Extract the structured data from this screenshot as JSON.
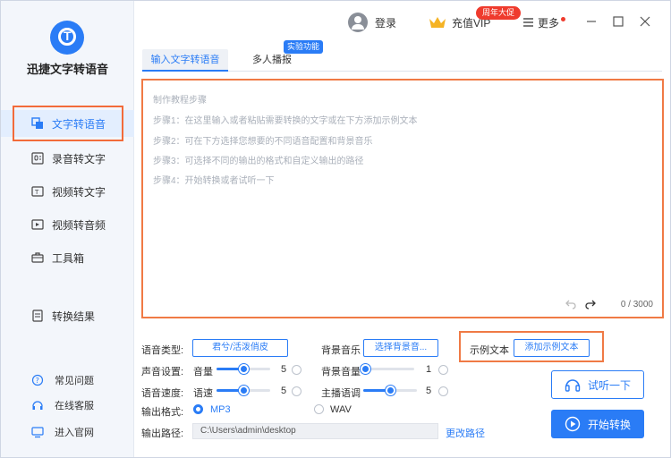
{
  "app": {
    "name": "迅捷文字转语音",
    "logo_letter": "T"
  },
  "sidebar": {
    "items": [
      {
        "label": "文字转语音",
        "icon": "text-to-speech-icon",
        "active": true
      },
      {
        "label": "录音转文字",
        "icon": "recording-icon",
        "active": false
      },
      {
        "label": "视频转文字",
        "icon": "video-text-icon",
        "active": false
      },
      {
        "label": "视频转音频",
        "icon": "video-audio-icon",
        "active": false
      },
      {
        "label": "工具箱",
        "icon": "toolbox-icon",
        "active": false
      },
      {
        "label": "转换结果",
        "icon": "results-icon",
        "active": false
      }
    ],
    "footer": [
      {
        "label": "常见问题",
        "icon": "help-icon"
      },
      {
        "label": "在线客服",
        "icon": "headset-icon"
      },
      {
        "label": "进入官网",
        "icon": "website-icon"
      }
    ]
  },
  "titlebar": {
    "login": "登录",
    "vip": "充值VIP",
    "promo": "周年大促",
    "more": "更多"
  },
  "tabs": {
    "tab1": "输入文字转语音",
    "tab2": "多人播报",
    "lab_badge": "实验功能"
  },
  "editor": {
    "lines": [
      "制作教程步骤",
      "步骤1：在这里输入或者粘贴需要转换的文字或在下方添加示例文本",
      "步骤2：可在下方选择您想要的不同语音配置和背景音乐",
      "步骤3：可选择不同的输出的格式和自定义输出的路径",
      "步骤4：开始转换或者试听一下"
    ],
    "count": "0 / 3000"
  },
  "settings": {
    "voice_type_label": "语音类型:",
    "voice_type_value": "君兮/活泼俏皮",
    "bg_music_label": "背景音乐",
    "bg_music_button": "选择背景音...",
    "example_label": "示例文本",
    "example_button": "添加示例文本",
    "sound_label": "声音设置:",
    "volume_label": "音量",
    "volume_value": "5",
    "volume_fraction": 0.5,
    "bg_volume_label": "背景音量",
    "bg_volume_value": "1",
    "bg_volume_fraction": 0.04,
    "speed_label": "语音速度:",
    "speed_sub_label": "语速",
    "speed_value": "5",
    "speed_fraction": 0.5,
    "pitch_label": "主播语调",
    "pitch_value": "5",
    "pitch_fraction": 0.5,
    "format_label": "输出格式:",
    "format_mp3": "MP3",
    "format_wav": "WAV",
    "path_label": "输出路径:",
    "path_value": "C:\\Users\\admin\\desktop",
    "change_path": "更改路径"
  },
  "actions": {
    "listen": "试听一下",
    "start": "开始转换"
  },
  "colors": {
    "accent": "#2a7cf6",
    "highlight": "#f07a45",
    "promo": "#ef3b2d"
  }
}
